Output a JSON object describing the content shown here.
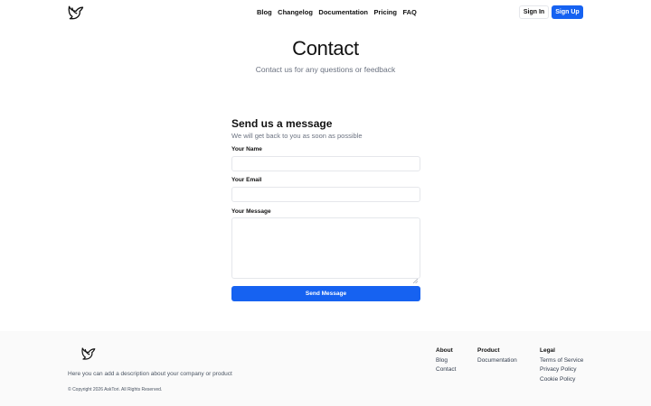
{
  "header": {
    "logo_icon": "dove-logo-icon",
    "nav": [
      "Blog",
      "Changelog",
      "Documentation",
      "Pricing",
      "FAQ"
    ],
    "sign_in": "Sign In",
    "sign_up": "Sign Up",
    "accent_color": "#1662f1"
  },
  "hero": {
    "title": "Contact",
    "subtitle": "Contact us for any questions or feedback"
  },
  "form": {
    "title": "Send us a message",
    "subtitle": "We will get back to you as soon as possible",
    "name_label": "Your Name",
    "name_value": "",
    "email_label": "Your Email",
    "email_value": "",
    "message_label": "Your Message",
    "message_value": "",
    "submit": "Send Message"
  },
  "footer": {
    "logo_icon": "dove-logo-icon",
    "description": "Here you can add a description about your company or product",
    "copyright": "© Copyright 2026 AskTori. All Rights Reserved.",
    "columns": [
      {
        "heading": "About",
        "links": [
          "Blog",
          "Contact"
        ]
      },
      {
        "heading": "Product",
        "links": [
          "Documentation"
        ]
      },
      {
        "heading": "Legal",
        "links": [
          "Terms of Service",
          "Privacy Policy",
          "Cookie Policy"
        ]
      }
    ]
  }
}
